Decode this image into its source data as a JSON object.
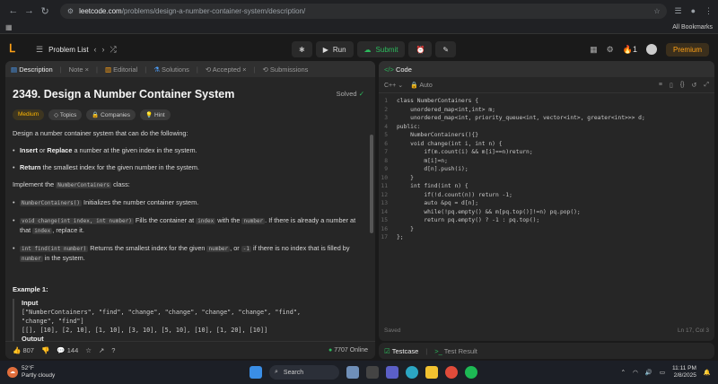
{
  "browser": {
    "url_host": "leetcode.com",
    "url_path": "/problems/design-a-number-container-system/description/",
    "bookmarks": "All Bookmarks"
  },
  "header": {
    "problem_list": "Problem List",
    "run": "Run",
    "submit": "Submit",
    "streak": "1",
    "premium": "Premium"
  },
  "tabs": [
    "Description",
    "Note",
    "Editorial",
    "Solutions",
    "Accepted",
    "Submissions"
  ],
  "problem": {
    "title": "2349. Design a Number Container System",
    "solved": "Solved",
    "tags": [
      "Medium",
      "Topics",
      "Companies",
      "Hint"
    ],
    "intro": "Design a number container system that can do the following:",
    "b1_bold": "Insert",
    "b1_mid": " or ",
    "b1_bold2": "Replace",
    "b1_rest": " a number at the given index in the system.",
    "b2_bold": "Return",
    "b2_rest": " the smallest index for the given number in the system.",
    "impl_pre": "Implement the ",
    "impl_code": "NumberContainers",
    "impl_post": " class:",
    "m1_code": "NumberContainers()",
    "m1_text": " Initializes the number container system.",
    "m2_code": "void change(int index, int number)",
    "m2_t1": " Fills the container at ",
    "m2_c2": "index",
    "m2_t2": " with the ",
    "m2_c3": "number",
    "m2_t3": ". If there is already a number at that ",
    "m2_c4": "index",
    "m2_t4": ", replace it.",
    "m3_code": "int find(int number)",
    "m3_t1": " Returns the smallest index for the given ",
    "m3_c2": "number",
    "m3_t2": ", or ",
    "m3_c3": "-1",
    "m3_t3": " if there is no index that is filled by ",
    "m3_c4": "number",
    "m3_t4": " in the system.",
    "example_title": "Example 1:",
    "input_label": "Input",
    "input_line1": "[\"NumberContainers\", \"find\", \"change\", \"change\", \"change\", \"change\", \"find\",",
    "input_line2": "\"change\", \"find\"]",
    "input_line3": "[[], [10], [2, 10], [1, 10], [3, 10], [5, 10], [10], [1, 20], [10]]",
    "output_label": "Output"
  },
  "left_footer": {
    "likes": "807",
    "comments": "144",
    "online": "7707 Online"
  },
  "editor": {
    "title": "Code",
    "lang": "C++",
    "auto": "Auto",
    "saved": "Saved",
    "cursor": "Ln 17, Col 3"
  },
  "code_lines": [
    "class NumberContainers {",
    "    unordered_map<int,int> m;",
    "    unordered_map<int, priority_queue<int, vector<int>, greater<int>>> d;",
    "public:",
    "    NumberContainers(){}",
    "    void change(int i, int n) {",
    "        if(m.count(i) && m[i]==n)return;",
    "        m[i]=n;",
    "        d[n].push(i);",
    "    }",
    "    int find(int n) {",
    "        if(!d.count(n)) return -1;",
    "        auto &pq = d[n];",
    "        while(!pq.empty() && m[pq.top()]!=n) pq.pop();",
    "        return pq.empty() ? -1 : pq.top();",
    "    }",
    "};"
  ],
  "bottom_tabs": [
    "Testcase",
    "Test Result"
  ],
  "taskbar": {
    "temp": "52°F",
    "weather": "Partly cloudy",
    "search": "Search",
    "time": "11:11 PM",
    "date": "2/8/2025"
  }
}
